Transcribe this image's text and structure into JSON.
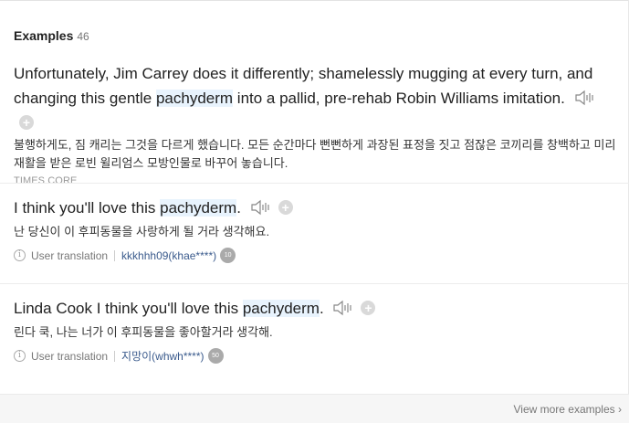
{
  "section": {
    "title": "Examples",
    "count": "46"
  },
  "examples": [
    {
      "en_before": "Unfortunately, Jim Carrey does it differently; shamelessly mugging at every turn, and changing this gentle ",
      "en_highlight": "pachyderm",
      "en_after": " into a pallid, pre-rehab Robin Williams imitation.",
      "ko": "불행하게도, 짐 캐리는 그것을 다르게 했습니다. 모든 순간마다 뻔뻔하게 과장된 표정을 짓고 점잖은 코끼리를 창백하고 미리 재활을 받은 로빈 윌리엄스 모방인물로 바꾸어 놓습니다.",
      "source": "TIMES CORE"
    },
    {
      "en_before": "I think you'll love this ",
      "en_highlight": "pachyderm",
      "en_after": ".",
      "ko": "난 당신이 이 후피동물을 사랑하게 될 거라 생각해요.",
      "meta_label": "User translation",
      "user": "kkkhhh09(khae****)",
      "level": "10"
    },
    {
      "en_before": "Linda Cook I think you'll love this ",
      "en_highlight": "pachyderm",
      "en_after": ".",
      "ko": "린다 쿡, 나는 너가 이 후피동물을 좋아할거라 생각해.",
      "meta_label": "User translation",
      "user": "지망이(whwh****)",
      "level": "50"
    }
  ],
  "icons": {
    "speaker": "speaker-icon",
    "add": "plus-icon",
    "info": "info-icon",
    "chevron": "chevron-right-icon"
  },
  "plus_symbol": "+",
  "info_symbol": "i",
  "footer": {
    "more_label": "View more examples",
    "chevron": "›"
  }
}
